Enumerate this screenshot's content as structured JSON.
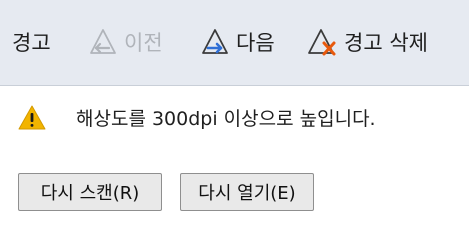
{
  "toolbar": {
    "title": "경고",
    "prev_label": "이전",
    "next_label": "다음",
    "delete_label": "경고 삭제"
  },
  "warning": {
    "message": "해상도를 300dpi 이상으로 높입니다."
  },
  "buttons": {
    "rescan_label": "다시 스캔(R)",
    "reopen_label": "다시 열기(E)"
  },
  "colors": {
    "toolbar_bg": "#e6eaf1",
    "warning_yellow": "#f2b400",
    "next_arrow_blue": "#2f6fd6",
    "delete_x_orange": "#e8590c",
    "disabled_gray": "#b0b4ba"
  },
  "icons": {
    "prev": "triangle-left-arrow-icon",
    "next": "triangle-right-arrow-icon",
    "delete": "triangle-x-icon",
    "warning": "warning-triangle-icon"
  },
  "state": {
    "prev_enabled": false
  }
}
